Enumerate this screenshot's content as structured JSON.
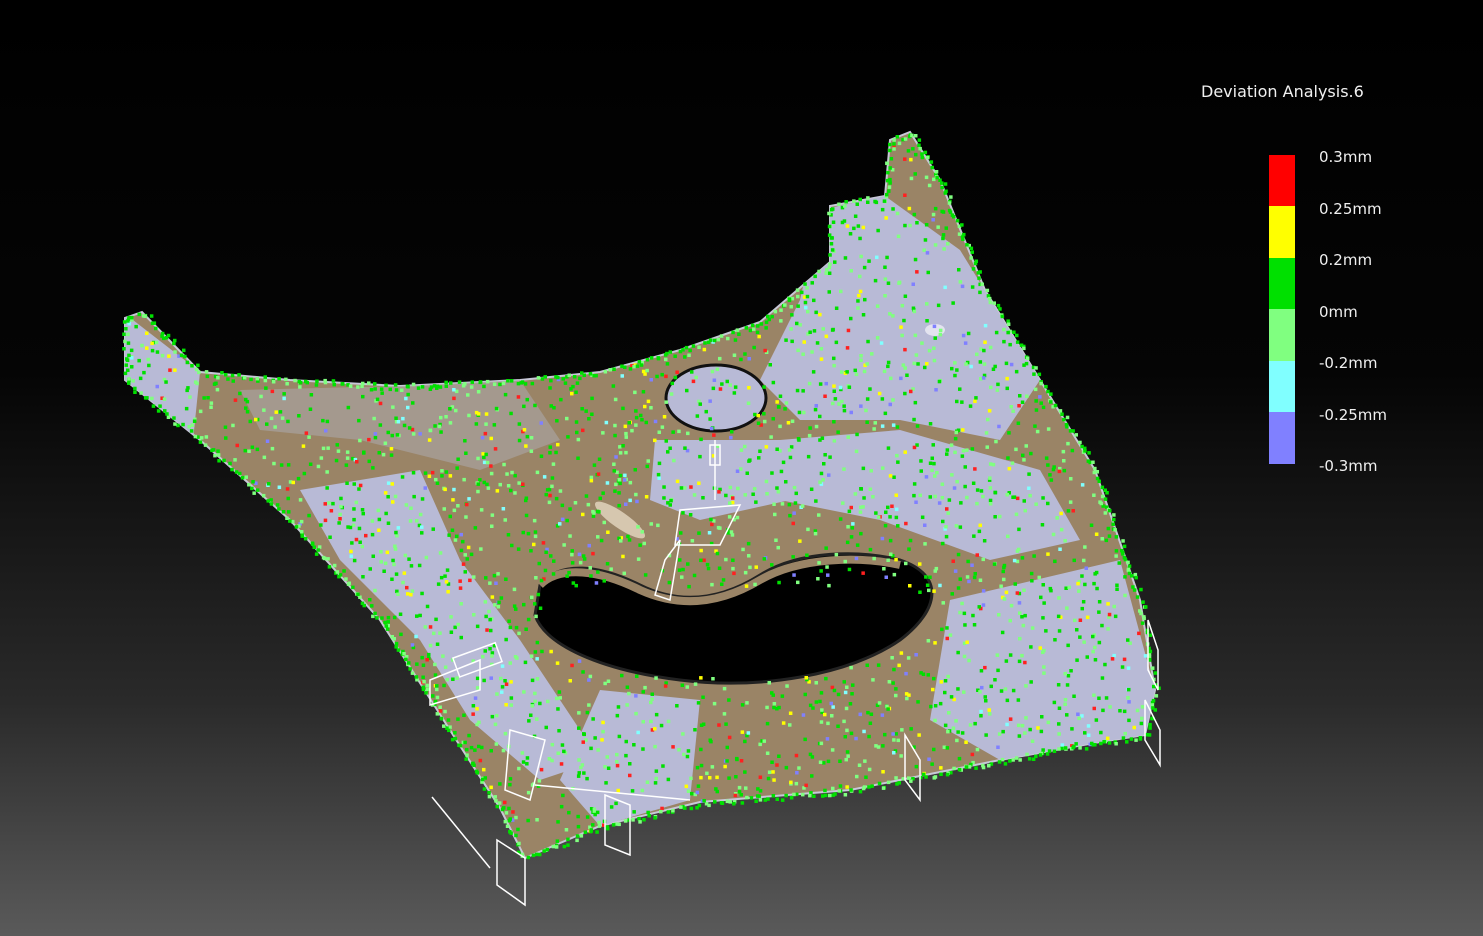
{
  "analysis": {
    "title": "Deviation Analysis.6"
  },
  "legend": {
    "entries": [
      {
        "label": "0.3mm",
        "color": "#ff0000"
      },
      {
        "label": "0.25mm",
        "color": "#ffff00"
      },
      {
        "label": "0.2mm",
        "color": "#00e000"
      },
      {
        "label": "0mm",
        "color": "#80ff80"
      },
      {
        "label": "-0.2mm",
        "color": "#80ffff"
      },
      {
        "label": "-0.25mm",
        "color": "#8080ff"
      },
      {
        "label": "-0.3mm",
        "color": ""
      }
    ]
  },
  "scene": {
    "part_base_color": "#9a8466",
    "part_negative_color": "#b8bad6",
    "point_colors": [
      "#00e000",
      "#80ff80",
      "#ffff00",
      "#ff2020",
      "#8080ff",
      "#80ffff"
    ]
  }
}
